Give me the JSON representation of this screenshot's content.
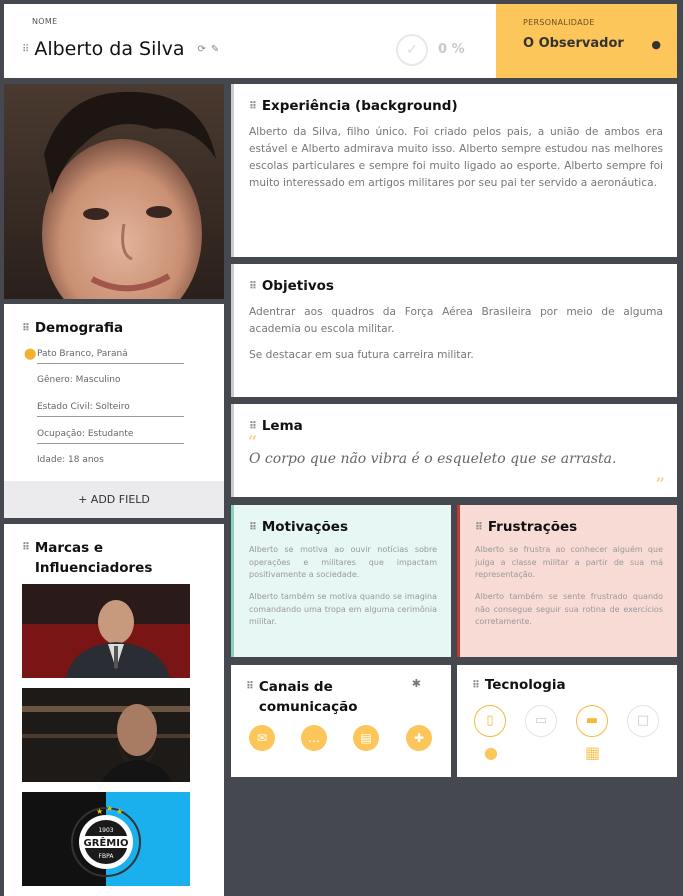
{
  "header": {
    "name_label": "NOME",
    "name": "Alberto da Silva",
    "progress": "0 %",
    "personality_label": "PERSONALIDADE",
    "personality": "O Observador"
  },
  "demografia": {
    "title": "Demografia",
    "location": "Pato Branco, Paraná",
    "gender": "Gênero: Masculino",
    "civil": "Estado Civil: Solteiro",
    "occupation": "Ocupação: Estudante",
    "age": "Idade: 18 anos",
    "add_field": "+ ADD FIELD"
  },
  "marcas": {
    "title": "Marcas e Influenciadores",
    "badge_top": "1903",
    "badge_name": "GRÊMIO",
    "badge_bottom": "FBPA"
  },
  "experiencia": {
    "title": "Experiência (background)",
    "text": "Alberto da Silva, filho único. Foi criado pelos pais, a união de ambos era estável e Alberto admirava muito isso. Alberto sempre estudou nas melhores escolas particulares e sempre foi muito ligado ao esporte. Alberto sempre foi muito interessado em artigos militares por seu pai ter servido a aeronáutica."
  },
  "objetivos": {
    "title": "Objetivos",
    "p1": "Adentrar aos quadros da Força Aérea Brasileira por meio de alguma academia ou escola militar.",
    "p2": "Se destacar em sua futura carreira militar."
  },
  "lema": {
    "title": "Lema",
    "text": "O corpo que não vibra é o esqueleto que se arrasta."
  },
  "motivacoes": {
    "title": "Motivações",
    "p1": "Alberto se motiva ao ouvir notícias sobre operações e militares que impactam positivamente a sociedade.",
    "p2": "Alberto também se motiva quando se imagina comandando uma tropa em alguma cerimônia militar."
  },
  "frustracoes": {
    "title": "Frustrações",
    "p1": "Alberto se frustra ao conhecer alguém que julga a classe militar a partir de sua má representação.",
    "p2": "Alberto também se sente frustrado quando não consegue seguir sua rotina de exercícios corretamente."
  },
  "canais": {
    "title": "Canais de comunicação",
    "icons": [
      "email-icon",
      "chat-icon",
      "browser-icon",
      "gamepad-icon"
    ]
  },
  "tecnologia": {
    "title": "Tecnologia",
    "devices": [
      {
        "icon": "smartphone-icon",
        "active": true
      },
      {
        "icon": "tablet-icon",
        "active": false
      },
      {
        "icon": "laptop-icon",
        "active": true
      },
      {
        "icon": "desktop-icon",
        "active": false
      }
    ],
    "os": [
      "apple-icon",
      "windows-icon"
    ]
  },
  "colors": {
    "accent": "#fdc65a",
    "background": "#45484e",
    "motivation_bg": "#e7f7f3",
    "frustration_bg": "#f9dbd6"
  }
}
